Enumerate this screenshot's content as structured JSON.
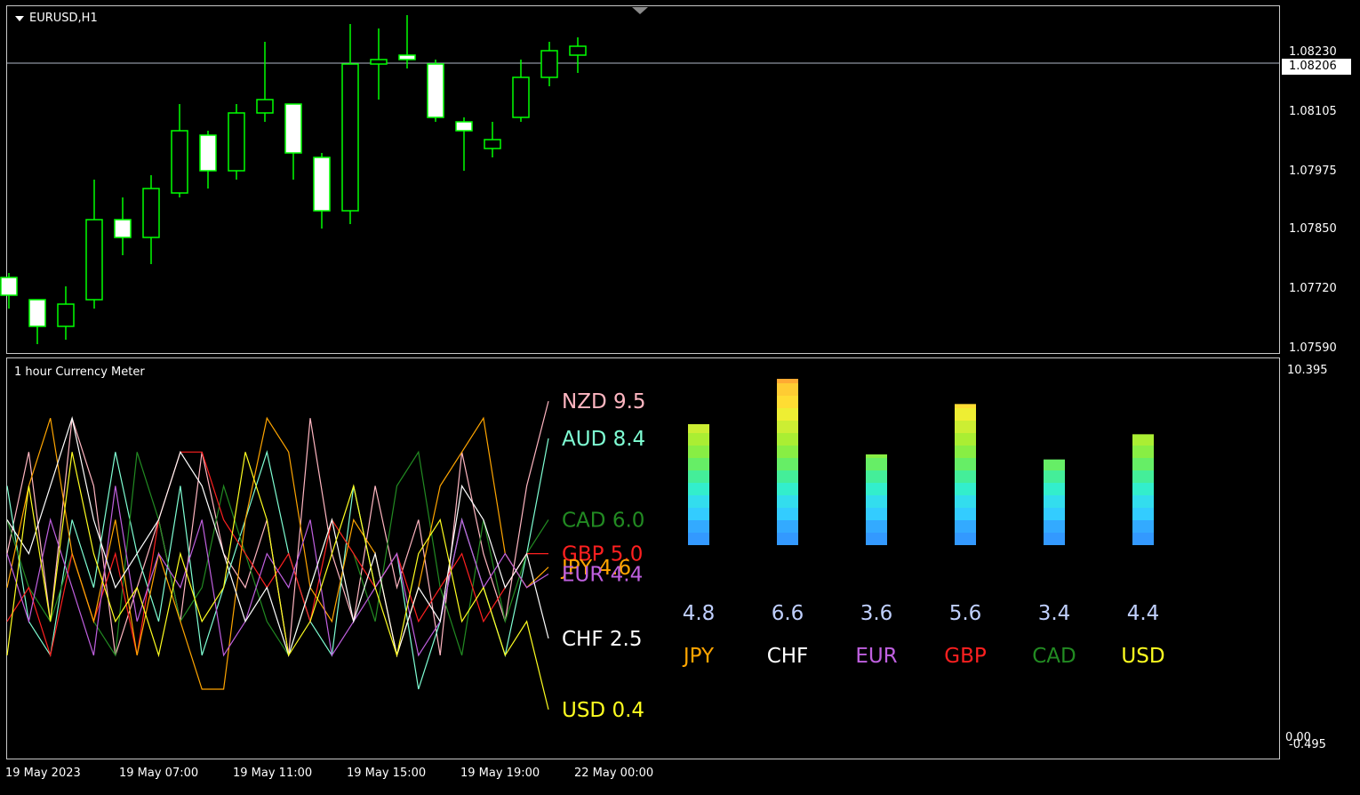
{
  "chart": {
    "symbol": "EURUSD,H1",
    "current_price": "1.08206",
    "price_axis": [
      "1.08230",
      "1.08105",
      "1.07975",
      "1.07850",
      "1.07720",
      "1.07590"
    ],
    "time_axis": [
      "19 May 2023",
      "19 May 07:00",
      "19 May 11:00",
      "19 May 15:00",
      "19 May 19:00",
      "22 May 00:00"
    ],
    "colors": {
      "background": "#000000",
      "candle": "#00ff00",
      "candle_body": "#ffffff",
      "grid_line": "#b0b8c8"
    }
  },
  "chart_data": [
    {
      "type": "candlestick",
      "title": "EURUSD,H1",
      "candles": [
        {
          "open": 1.0773,
          "high": 1.0774,
          "low": 1.0766,
          "close": 1.0769
        },
        {
          "open": 1.0768,
          "high": 1.0768,
          "low": 1.0758,
          "close": 1.0762
        },
        {
          "open": 1.0762,
          "high": 1.0771,
          "low": 1.0759,
          "close": 1.0767
        },
        {
          "open": 1.0768,
          "high": 1.0795,
          "low": 1.0766,
          "close": 1.0786
        },
        {
          "open": 1.0786,
          "high": 1.0791,
          "low": 1.0778,
          "close": 1.0782
        },
        {
          "open": 1.0782,
          "high": 1.0796,
          "low": 1.0776,
          "close": 1.0793
        },
        {
          "open": 1.0792,
          "high": 1.0812,
          "low": 1.0791,
          "close": 1.0806
        },
        {
          "open": 1.0805,
          "high": 1.0806,
          "low": 1.0793,
          "close": 1.0797
        },
        {
          "open": 1.0797,
          "high": 1.0812,
          "low": 1.0795,
          "close": 1.081
        },
        {
          "open": 1.081,
          "high": 1.0826,
          "low": 1.0808,
          "close": 1.0813
        },
        {
          "open": 1.0812,
          "high": 1.0812,
          "low": 1.0795,
          "close": 1.0801
        },
        {
          "open": 1.08,
          "high": 1.0801,
          "low": 1.0784,
          "close": 1.0788
        },
        {
          "open": 1.0788,
          "high": 1.083,
          "low": 1.0785,
          "close": 1.0821
        },
        {
          "open": 1.0821,
          "high": 1.0829,
          "low": 1.0813,
          "close": 1.0822
        },
        {
          "open": 1.0823,
          "high": 1.0832,
          "low": 1.082,
          "close": 1.0822
        },
        {
          "open": 1.0821,
          "high": 1.0822,
          "low": 1.0808,
          "close": 1.0809
        },
        {
          "open": 1.0808,
          "high": 1.0809,
          "low": 1.0797,
          "close": 1.0806
        },
        {
          "open": 1.0802,
          "high": 1.0808,
          "low": 1.08,
          "close": 1.0804
        },
        {
          "open": 1.0809,
          "high": 1.0822,
          "low": 1.0808,
          "close": 1.0818
        },
        {
          "open": 1.0818,
          "high": 1.0826,
          "low": 1.0816,
          "close": 1.0824
        },
        {
          "open": 1.0823,
          "high": 1.0827,
          "low": 1.0819,
          "close": 1.0825
        }
      ],
      "ylim": [
        1.0757,
        1.0833
      ]
    },
    {
      "type": "line",
      "title": "1 hour Currency Meter",
      "ylim": [
        -0.495,
        10.395
      ],
      "series": [
        {
          "name": "NZD",
          "color": "#ffb6c1",
          "values": [
            5,
            8,
            3,
            9,
            7,
            2,
            4,
            6,
            3,
            8,
            5,
            4,
            6,
            2,
            9,
            5,
            3,
            7,
            4,
            6,
            2,
            8,
            5,
            3,
            7,
            9.5
          ]
        },
        {
          "name": "AUD",
          "color": "#7fffd4",
          "values": [
            7,
            3,
            2,
            6,
            4,
            8,
            5,
            3,
            7,
            2,
            4,
            6,
            8,
            5,
            3,
            2,
            7,
            4,
            5,
            1,
            3,
            6,
            4,
            2,
            5,
            8.4
          ]
        },
        {
          "name": "CAD",
          "color": "#228b22",
          "values": [
            6,
            4,
            3,
            5,
            3,
            2,
            8,
            6,
            3,
            4,
            7,
            5,
            3,
            2,
            4,
            6,
            5,
            3,
            7,
            8,
            4,
            2,
            6,
            3,
            5,
            6.0
          ]
        },
        {
          "name": "GBP",
          "color": "#ff2020",
          "values": [
            3,
            4,
            2,
            5,
            3,
            5,
            2,
            6,
            8,
            8,
            6,
            5,
            4,
            5,
            3,
            6,
            5,
            4,
            5,
            3,
            4,
            5,
            3,
            4,
            5,
            5.0
          ]
        },
        {
          "name": "JPY",
          "color": "#ffa500",
          "values": [
            4,
            7,
            9,
            5,
            3,
            6,
            2,
            5,
            3,
            1,
            1,
            6,
            9,
            8,
            4,
            3,
            6,
            5,
            2,
            4,
            7,
            8,
            9,
            5,
            4,
            4.6
          ]
        },
        {
          "name": "EUR",
          "color": "#c060e0",
          "values": [
            5,
            3,
            6,
            4,
            2,
            7,
            3,
            5,
            4,
            6,
            2,
            3,
            5,
            4,
            6,
            2,
            3,
            4,
            5,
            2,
            3,
            6,
            4,
            5,
            4,
            4.4
          ]
        },
        {
          "name": "CHF",
          "color": "#ffffff",
          "values": [
            6,
            5,
            7,
            9,
            6,
            4,
            5,
            6,
            8,
            7,
            5,
            3,
            4,
            2,
            4,
            6,
            3,
            5,
            2,
            4,
            3,
            7,
            6,
            4,
            5,
            2.5
          ]
        },
        {
          "name": "USD",
          "color": "#ffff20",
          "values": [
            2,
            7,
            3,
            8,
            5,
            3,
            4,
            2,
            5,
            3,
            4,
            8,
            6,
            2,
            3,
            5,
            7,
            4,
            2,
            5,
            6,
            3,
            4,
            2,
            3,
            0.4
          ]
        }
      ],
      "labels": [
        {
          "text": "NZD 9.5",
          "color": "#ffb6c1",
          "value": 9.5
        },
        {
          "text": "AUD 8.4",
          "color": "#7fffd4",
          "value": 8.4
        },
        {
          "text": "CAD 6.0",
          "color": "#228b22",
          "value": 6.0
        },
        {
          "text": "GBP 5.0",
          "color": "#ff2020",
          "value": 5.0
        },
        {
          "text": "JPY 4.6",
          "color": "#ffa500",
          "value": 4.6
        },
        {
          "text": "EUR 4.4",
          "color": "#c060e0",
          "value": 4.4
        },
        {
          "text": "CHF 2.5",
          "color": "#ffffff",
          "value": 2.5
        },
        {
          "text": "USD 0.4",
          "color": "#ffff20",
          "value": 0.4
        }
      ]
    },
    {
      "type": "bar",
      "categories": [
        "JPY",
        "CHF",
        "EUR",
        "GBP",
        "CAD",
        "USD"
      ],
      "values": [
        4.8,
        6.6,
        3.6,
        5.6,
        3.4,
        4.4
      ],
      "value_labels": [
        "4.8",
        "6.6",
        "3.6",
        "5.6",
        "3.4",
        "4.4"
      ],
      "category_colors": [
        "#ffa500",
        "#ffffff",
        "#c060e0",
        "#ff2020",
        "#228b22",
        "#ffff20"
      ],
      "ylim": [
        0,
        7
      ]
    }
  ],
  "indicator": {
    "title": "1 hour Currency Meter",
    "axis_top": "10.395",
    "axis_bottom": "0.00",
    "axis_bottom_alt": "-0.495"
  }
}
